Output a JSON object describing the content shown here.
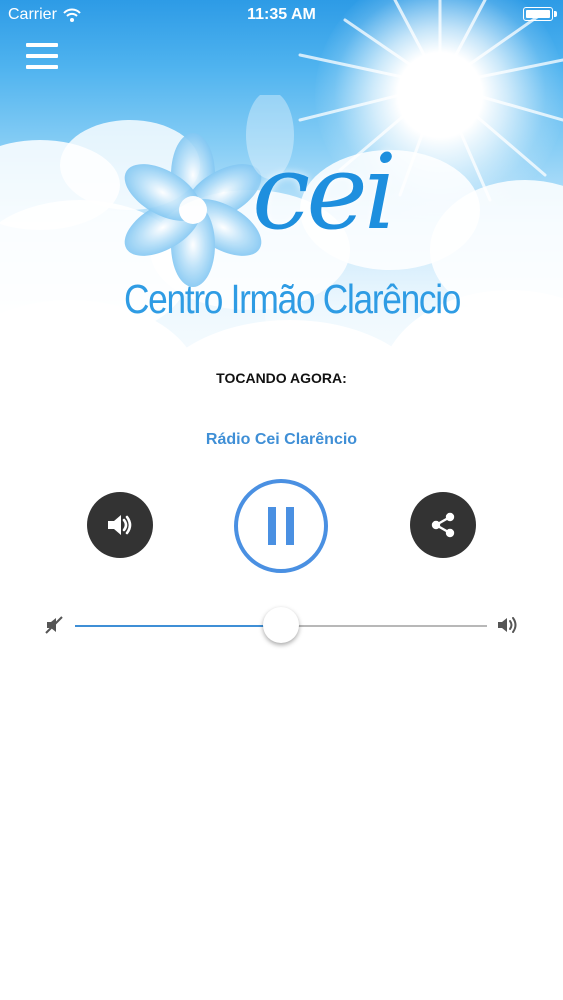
{
  "status_bar": {
    "carrier": "Carrier",
    "time": "11:35 AM",
    "battery_level": 1.0
  },
  "header": {
    "menu_icon": "hamburger-menu-icon"
  },
  "logo": {
    "brand": "cei",
    "subtitle": "Centro Irmão Clarêncio"
  },
  "player": {
    "now_playing_label": "TOCANDO AGORA:",
    "station_name": "Rádio Cei Clarêncio",
    "state": "playing",
    "buttons": {
      "volume": "speaker-icon",
      "play_pause": "pause-icon",
      "share": "share-icon"
    }
  },
  "volume": {
    "level": 0.5,
    "min_icon": "volume-mute-icon",
    "max_icon": "volume-high-icon"
  },
  "colors": {
    "accent": "#3f8fd6",
    "button_dark": "#333333",
    "sky": "#2d9be6"
  }
}
